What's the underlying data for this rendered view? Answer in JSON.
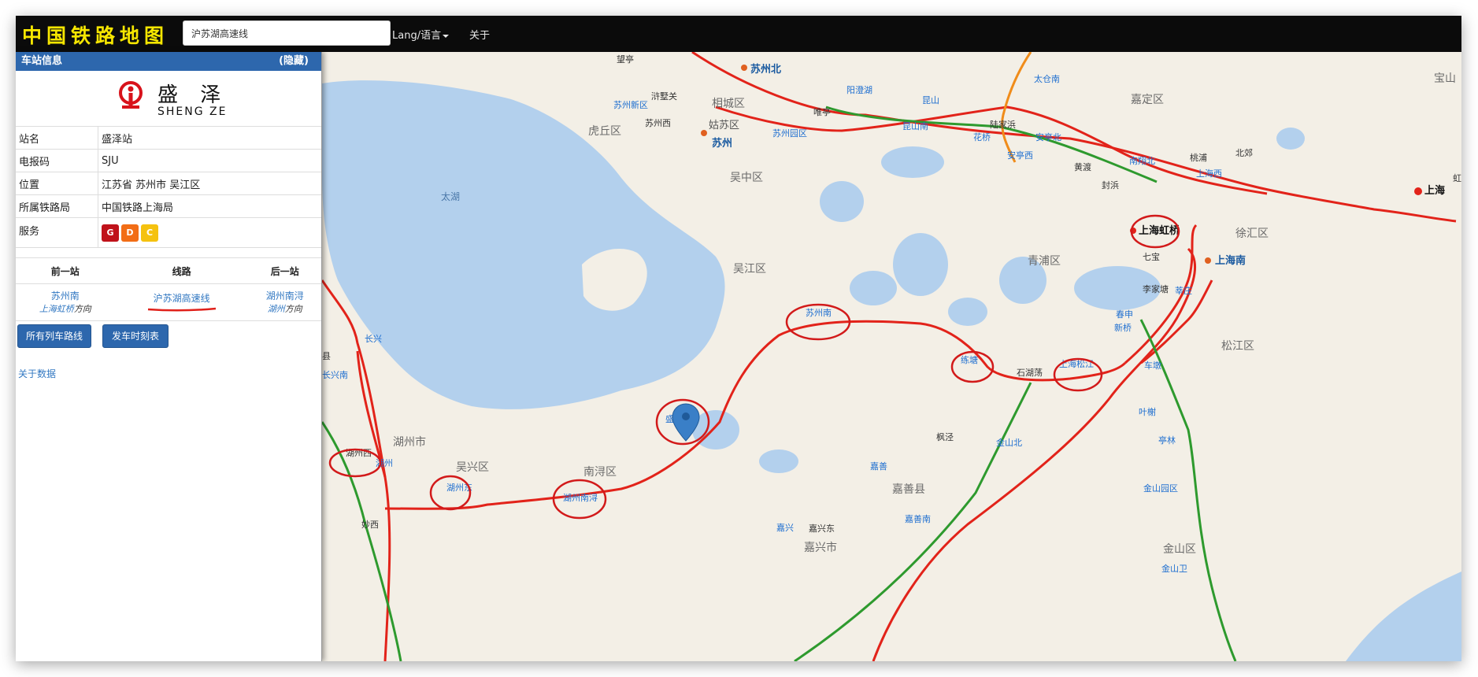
{
  "app": {
    "title": "中国铁路地图",
    "search_value": "沪苏湖高速线",
    "lang_menu": "Lang/语言",
    "about": "关于"
  },
  "panel": {
    "header": "车站信息",
    "hide": "(隐藏)",
    "station_cn": "盛 泽",
    "station_py": "SHENG ZE",
    "rows": [
      {
        "key": "站名",
        "value": "盛泽站"
      },
      {
        "key": "电报码",
        "value": "SJU"
      },
      {
        "key": "位置",
        "value": "江苏省 苏州市 吴江区"
      },
      {
        "key": "所属铁路局",
        "value": "中国铁路上海局"
      },
      {
        "key": "服务",
        "value": ""
      }
    ],
    "services": [
      {
        "label": "G",
        "color": "#c0121a"
      },
      {
        "label": "D",
        "color": "#f26d16"
      },
      {
        "label": "C",
        "color": "#f5c20f"
      }
    ],
    "nav_headers": {
      "prev": "前一站",
      "line": "线路",
      "next": "后一站"
    },
    "prev_station": "苏州南",
    "prev_dir_station": "上海虹桥",
    "next_station": "湖州南浔",
    "next_dir_station": "湖州",
    "direction_word": "方向",
    "line_name": "沪苏湖高速线",
    "btn_routes": "所有列车路线",
    "btn_timetable": "发车时刻表",
    "about_data": "关于数据"
  },
  "map": {
    "colors": {
      "land": "#f3efe6",
      "water": "#b3d0ed",
      "hsr": "#e2231a",
      "rail_green": "#2e9a2e",
      "rail_orange": "#f08c1a",
      "circle": "#d21a1a",
      "marker": "#3a7fc7"
    },
    "water_labels": [
      "太湖"
    ],
    "district_labels": [
      "虎丘区",
      "相城区",
      "嘉定区",
      "宝山",
      "吴中区",
      "吴江区",
      "青浦区",
      "徐汇区",
      "松江区",
      "嘉善县",
      "湖州市",
      "吴兴区",
      "南浔区",
      "嘉兴市",
      "金山区"
    ],
    "station_labels_bold": [
      "苏州北",
      "苏州",
      "上海",
      "上海虹桥",
      "上海南"
    ],
    "station_labels_blue": [
      "苏州新区",
      "苏州园区",
      "阳澄湖",
      "昆山",
      "昆山南",
      "花桥",
      "安亭北",
      "安亭西",
      "太仓南",
      "南翔北",
      "上海西",
      "莘庄",
      "春申",
      "新桥",
      "车墩",
      "叶榭",
      "亭林",
      "金山园区",
      "上海松江",
      "练塘",
      "苏州南",
      "盛泽",
      "湖州南浔",
      "湖州东",
      "湖州",
      "长兴",
      "长兴南",
      "嘉善",
      "嘉善南",
      "嘉兴",
      "金山北",
      "金山卫"
    ],
    "station_labels_plain": [
      "望亭",
      "浒墅关",
      "苏州西",
      "姑苏区",
      "唯亭",
      "陆家浜",
      "黄渡",
      "封浜",
      "桃浦",
      "北郊",
      "七宝",
      "李家塘",
      "石湖荡",
      "枫泾",
      "嘉兴东",
      "湖州西",
      "妙西",
      "县",
      "虹"
    ]
  }
}
